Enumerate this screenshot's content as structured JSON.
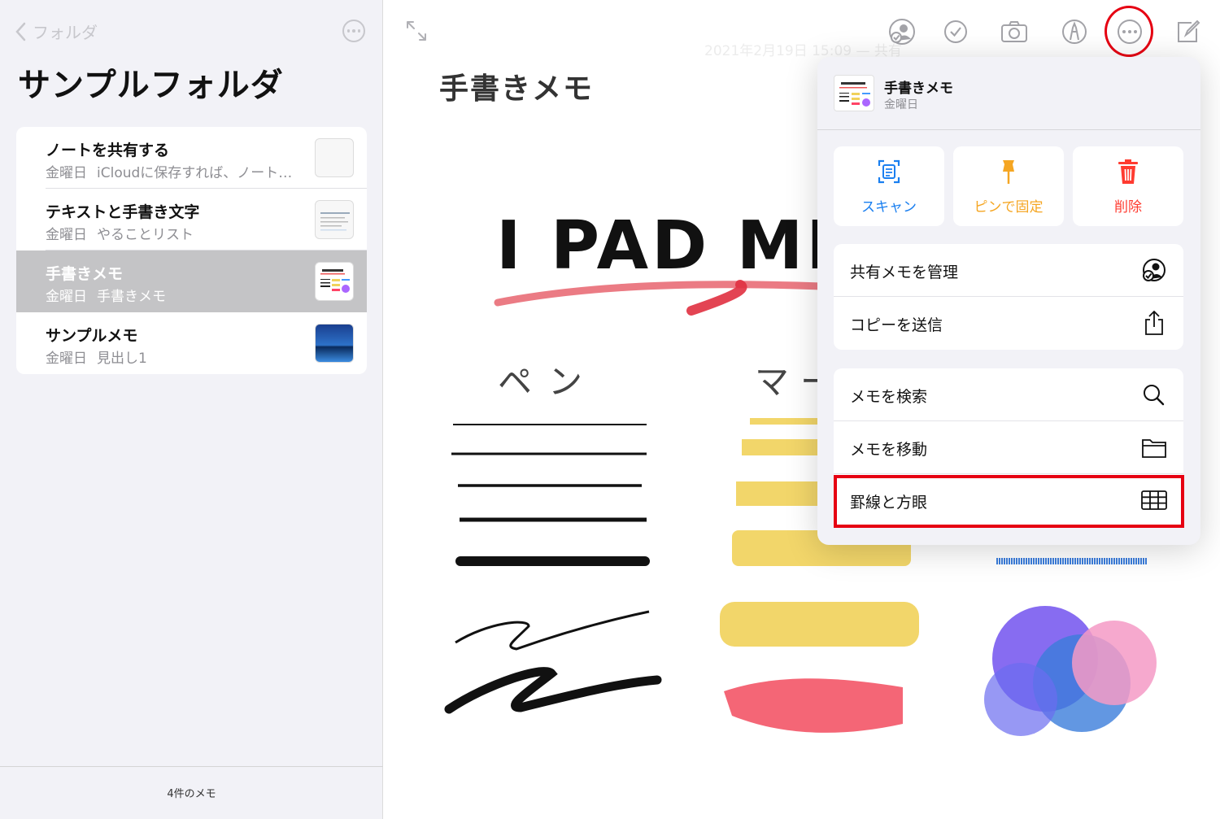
{
  "sidebar": {
    "back_label": "フォルダ",
    "folder_title": "サンプルフォルダ",
    "notes": [
      {
        "title": "ノートを共有する",
        "date": "金曜日",
        "preview": "iCloudに保存すれば、ノート…",
        "selected": false
      },
      {
        "title": "テキストと手書き文字",
        "date": "金曜日",
        "preview": "やることリスト",
        "selected": false
      },
      {
        "title": "手書きメモ",
        "date": "金曜日",
        "preview": "手書きメモ",
        "selected": true
      },
      {
        "title": "サンプルメモ",
        "date": "金曜日",
        "preview": "見出し1",
        "selected": false
      }
    ],
    "count_label": "4件のメモ"
  },
  "note": {
    "title": "手書きメモ",
    "date_faint": "2021年2月19日 15:09 — 共有",
    "drawing": {
      "heading": "I PAD MEM",
      "col1": "ペン",
      "col2": "マー"
    }
  },
  "toolbar": {
    "icons": [
      "share-people-icon",
      "checklist-icon",
      "camera-icon",
      "markup-pen-icon",
      "more-icon",
      "compose-icon"
    ]
  },
  "popover": {
    "note_title": "手書きメモ",
    "note_date": "金曜日",
    "actions": [
      {
        "label": "スキャン",
        "icon": "scan-icon",
        "color": "#1a7ff0"
      },
      {
        "label": "ピンで固定",
        "icon": "pin-icon",
        "color": "#f5a623"
      },
      {
        "label": "削除",
        "icon": "trash-icon",
        "color": "#ff3b30"
      }
    ],
    "group1": [
      {
        "label": "共有メモを管理",
        "icon": "manage-share-icon"
      },
      {
        "label": "コピーを送信",
        "icon": "share-upload-icon"
      }
    ],
    "group2": [
      {
        "label": "メモを検索",
        "icon": "search-icon"
      },
      {
        "label": "メモを移動",
        "icon": "folder-icon"
      },
      {
        "label": "罫線と方眼",
        "icon": "grid-icon"
      }
    ]
  },
  "colors": {
    "highlight": "#e60012",
    "accent": "#1a7ff0",
    "selected_row": "#c4c4c6"
  }
}
